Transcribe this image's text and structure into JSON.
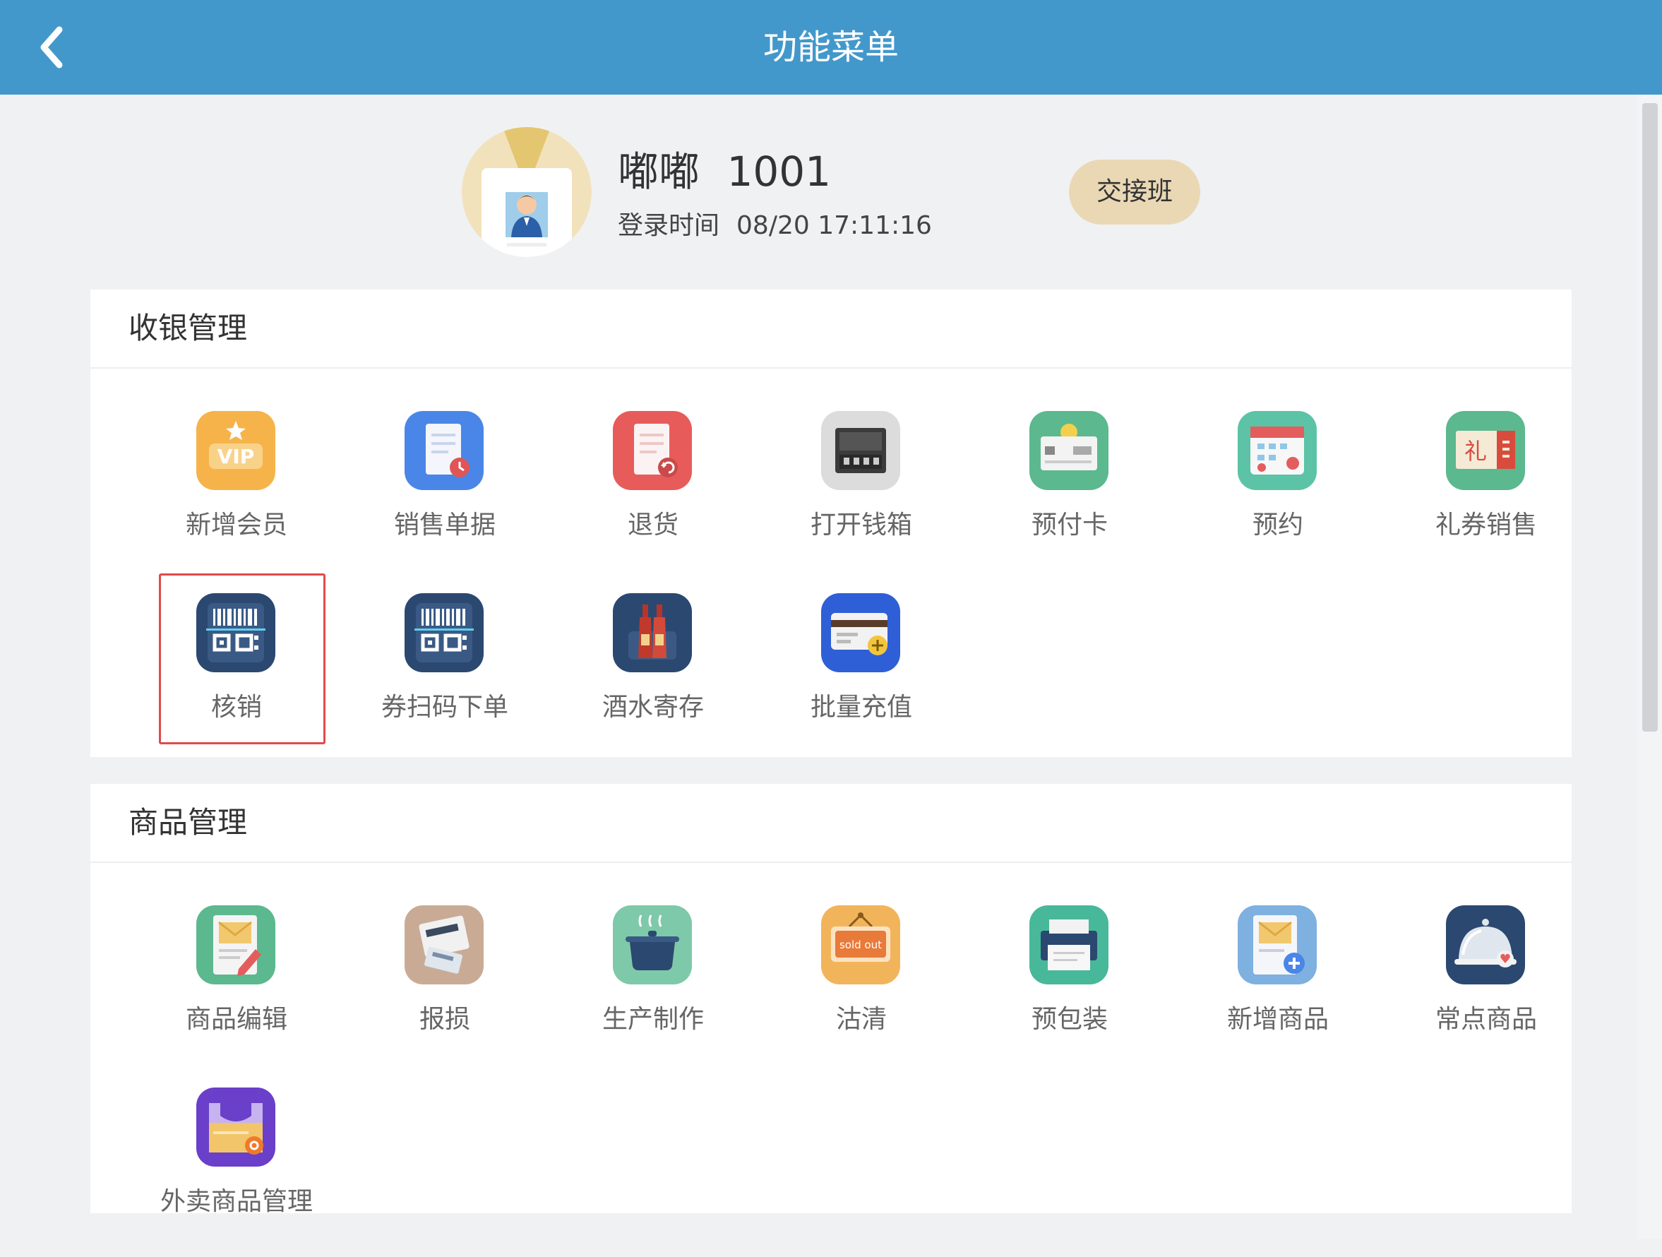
{
  "header": {
    "title": "功能菜单",
    "back_icon": "chevron-left-icon"
  },
  "profile": {
    "name": "嘟嘟",
    "id": "1001",
    "login_label": "登录时间",
    "login_time": "08/20 17:11:16",
    "shift_button": "交接班"
  },
  "sections": [
    {
      "title": "收银管理",
      "items": [
        {
          "label": "新增会员",
          "icon": "vip-card-icon",
          "color": "#f6b34a"
        },
        {
          "label": "销售单据",
          "icon": "sales-receipt-icon",
          "color": "#4a86e8"
        },
        {
          "label": "退货",
          "icon": "return-receipt-icon",
          "color": "#e85b5b"
        },
        {
          "label": "打开钱箱",
          "icon": "cash-drawer-icon",
          "color": "#dcdcdc"
        },
        {
          "label": "预付卡",
          "icon": "prepaid-card-icon",
          "color": "#5cb88e"
        },
        {
          "label": "预约",
          "icon": "calendar-icon",
          "color": "#5cc3a6"
        },
        {
          "label": "礼券销售",
          "icon": "gift-voucher-icon",
          "color": "#5cb88e",
          "glyph": "礼"
        },
        {
          "label": "核销",
          "icon": "qr-scan-icon",
          "color": "#2b4870",
          "selected": true
        },
        {
          "label": "券扫码下单",
          "icon": "coupon-qr-scan-icon",
          "color": "#2b4870"
        },
        {
          "label": "酒水寄存",
          "icon": "wine-bottles-icon",
          "color": "#2b4870"
        },
        {
          "label": "批量充值",
          "icon": "card-topup-icon",
          "color": "#2f5fd6"
        }
      ]
    },
    {
      "title": "商品管理",
      "items": [
        {
          "label": "商品编辑",
          "icon": "product-edit-icon",
          "color": "#5cb88e"
        },
        {
          "label": "报损",
          "icon": "damage-report-icon",
          "color": "#c9ab95"
        },
        {
          "label": "生产制作",
          "icon": "cooking-pot-icon",
          "color": "#7ec9a9"
        },
        {
          "label": "沽清",
          "icon": "sold-out-sign-icon",
          "color": "#f2b45a",
          "glyph": "sold out"
        },
        {
          "label": "预包装",
          "icon": "prepack-printer-icon",
          "color": "#48b89a"
        },
        {
          "label": "新增商品",
          "icon": "add-product-icon",
          "color": "#7eb0e0"
        },
        {
          "label": "常点商品",
          "icon": "cloche-icon",
          "color": "#2b4870"
        },
        {
          "label": "外卖商品管理",
          "icon": "takeout-bag-icon",
          "color": "#6a3fc9"
        }
      ]
    }
  ]
}
